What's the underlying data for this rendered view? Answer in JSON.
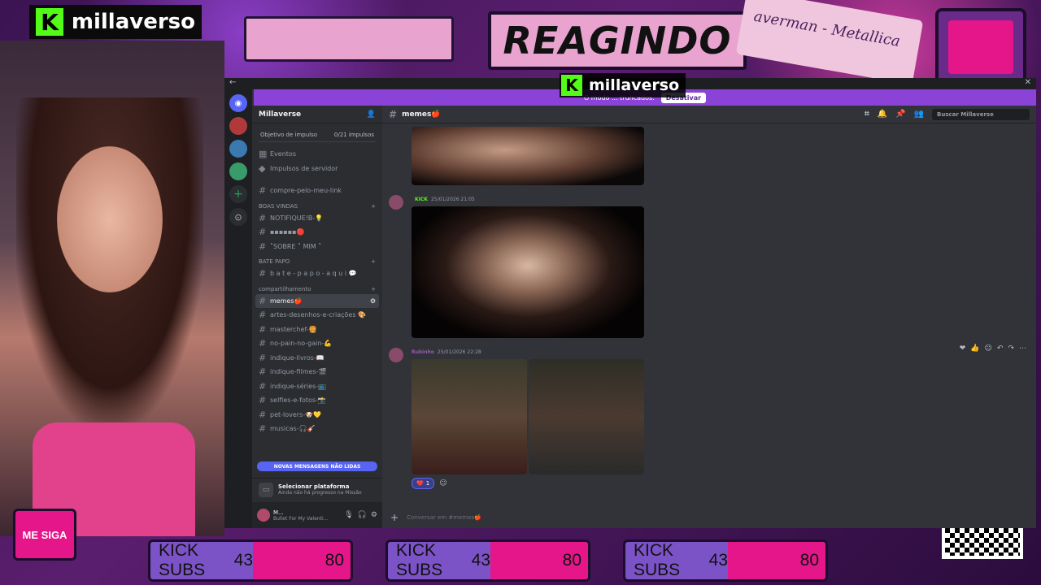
{
  "overlay": {
    "brand_name": "millaverso",
    "header_title": "REAGINDO",
    "sticky_note": "averman - Metallica",
    "follow_label": "ME SIGA",
    "sub_bars": [
      {
        "label": "KICK SUBS",
        "current": "43",
        "goal": "80"
      },
      {
        "label": "KICK SUBS",
        "current": "43",
        "goal": "80"
      },
      {
        "label": "KICK SUBS",
        "current": "43",
        "goal": "80"
      }
    ],
    "colors": {
      "kick_green": "#53fc18",
      "accent_pink": "#e5158a",
      "overlay_purple": "#7c52c7"
    }
  },
  "discord": {
    "banner_text": "O modo ... truncados.",
    "banner_button": "Desativar",
    "server_name": "Millaverse",
    "boost_goal_label": "Objetivo de impulso",
    "boost_goal_value": "0/21 impulsos",
    "nav_items": [
      "Eventos",
      "Impulsos de servidor"
    ],
    "top_channels": [
      "compre-pelo-meu-link"
    ],
    "categories": [
      {
        "name": "BOAS VINDAS",
        "channels": [
          "NOTIFIQUE!B-💡",
          "▪▪▪▪▪▪🔴",
          "˚SOBRE ˚ MIM ˚"
        ]
      },
      {
        "name": "BATE PAPO",
        "channels": [
          "b a t e - p a p o - a q u i 💬"
        ]
      },
      {
        "name": "compartilhamento",
        "channels": [
          "memes🍎",
          "artes-desenhos-e-criações 🎨",
          "masterchef-🍔",
          "no-pain-no-gain-💪",
          "indique-livros-📖",
          "indique-filmes-🎬",
          "indique-séries-📺",
          "selfies-e-fotos-📸",
          "pet-lovers-🐶💛",
          "musicas-🎧🎸"
        ]
      }
    ],
    "active_channel": "memes🍎",
    "new_messages_label": "NOVAS MENSAGENS NÃO LIDAS",
    "mission_title": "Selecionar plataforma",
    "mission_sub": "Ainda não há progresso na Missão",
    "user_name": "M...",
    "user_status": "Bullet For My Valenti...",
    "channel_title": "memes🍎",
    "search_placeholder": "Buscar Millaverse",
    "messages": [
      {
        "author": "",
        "badge": "KICK",
        "timestamp": "25/01/2026 21:05"
      },
      {
        "author": "Rubinho",
        "badge": "",
        "timestamp": "25/01/2026 22:28"
      }
    ],
    "reaction": {
      "emoji": "❤️",
      "count": "1"
    },
    "composer_placeholder": "Conversar em #memes🍎"
  }
}
